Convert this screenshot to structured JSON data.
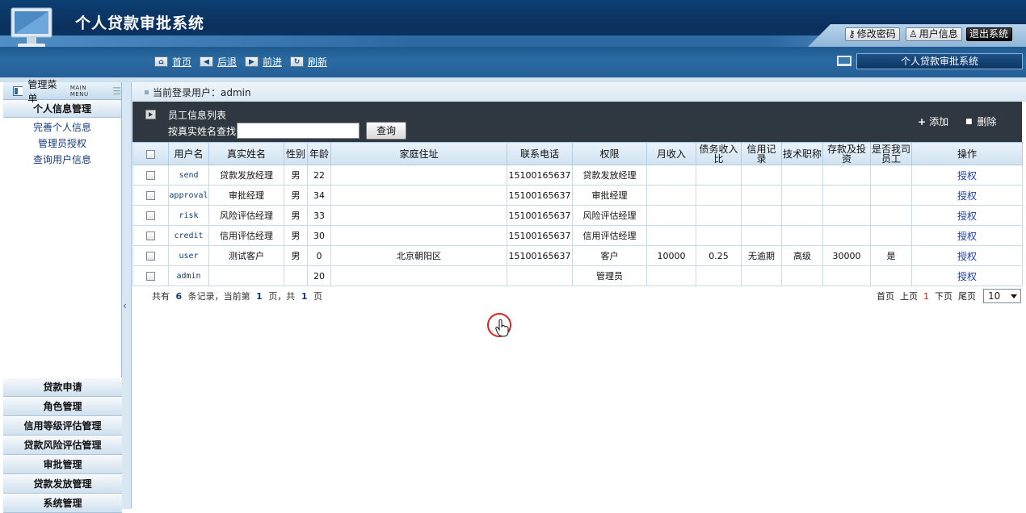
{
  "header": {
    "app_title": "个人贷款审批系统",
    "change_password": "修改密码",
    "user_info": "用户信息",
    "logout": "退出系统"
  },
  "navbar": {
    "home": "首页",
    "back": "后退",
    "forward": "前进",
    "refresh": "刷新",
    "system_name": "个人贷款审批系统"
  },
  "sidebar": {
    "title": "管理菜单",
    "title_en": "MAIN MENU",
    "active_group": "个人信息管理",
    "sub_items": [
      "完善个人信息",
      "管理员授权",
      "查询用户信息"
    ],
    "groups": [
      "贷款申请",
      "角色管理",
      "信用等级评估管理",
      "贷款风险评估管理",
      "审批管理",
      "贷款发放管理",
      "系统管理"
    ]
  },
  "breadcrumb": {
    "text": "当前登录用户：admin"
  },
  "panel": {
    "title": "员工信息列表",
    "search_label": "按真实姓名查找",
    "search_value": "",
    "search_button": "查询",
    "add": "添加",
    "delete": "删除"
  },
  "table": {
    "headers": [
      "用户名",
      "真实姓名",
      "性别",
      "年龄",
      "家庭住址",
      "联系电话",
      "权限",
      "月收入",
      "债务收入比",
      "信用记录",
      "技术职称",
      "存款及投资",
      "是否我司员工",
      "操作"
    ],
    "rows": [
      [
        "send",
        "贷款发放经理",
        "男",
        "22",
        "",
        "15100165637",
        "贷款发放经理",
        "",
        "",
        "",
        "",
        "",
        "",
        "授权"
      ],
      [
        "approval",
        "审批经理",
        "男",
        "34",
        "",
        "15100165637",
        "审批经理",
        "",
        "",
        "",
        "",
        "",
        "",
        "授权"
      ],
      [
        "risk",
        "风险评估经理",
        "男",
        "33",
        "",
        "15100165637",
        "风险评估经理",
        "",
        "",
        "",
        "",
        "",
        "",
        "授权"
      ],
      [
        "credit",
        "信用评估经理",
        "男",
        "30",
        "",
        "15100165637",
        "信用评估经理",
        "",
        "",
        "",
        "",
        "",
        "",
        "授权"
      ],
      [
        "user",
        "测试客户",
        "男",
        "0",
        "北京朝阳区",
        "15100165637",
        "客户",
        "10000",
        "0.25",
        "无逾期",
        "高级",
        "30000",
        "是",
        "授权"
      ],
      [
        "admin",
        "",
        "",
        "20",
        "",
        "",
        "管理员",
        "",
        "",
        "",
        "",
        "",
        "",
        "授权"
      ]
    ]
  },
  "pager": {
    "prefix": "共有",
    "total": "6",
    "mid1": "条记录，当前第",
    "current": "1",
    "mid2": "页，共",
    "pages": "1",
    "suffix": "页",
    "first": "首页",
    "prev": "上页",
    "page_num": "1",
    "next": "下页",
    "last": "尾页",
    "page_size": "10"
  },
  "colors": {
    "header_bg": "#0d3f73",
    "nav_bg": "#2a6ba2",
    "panel_bg": "#2f3740",
    "link": "#1a3ea8",
    "cursor_ring": "#d6261d"
  }
}
